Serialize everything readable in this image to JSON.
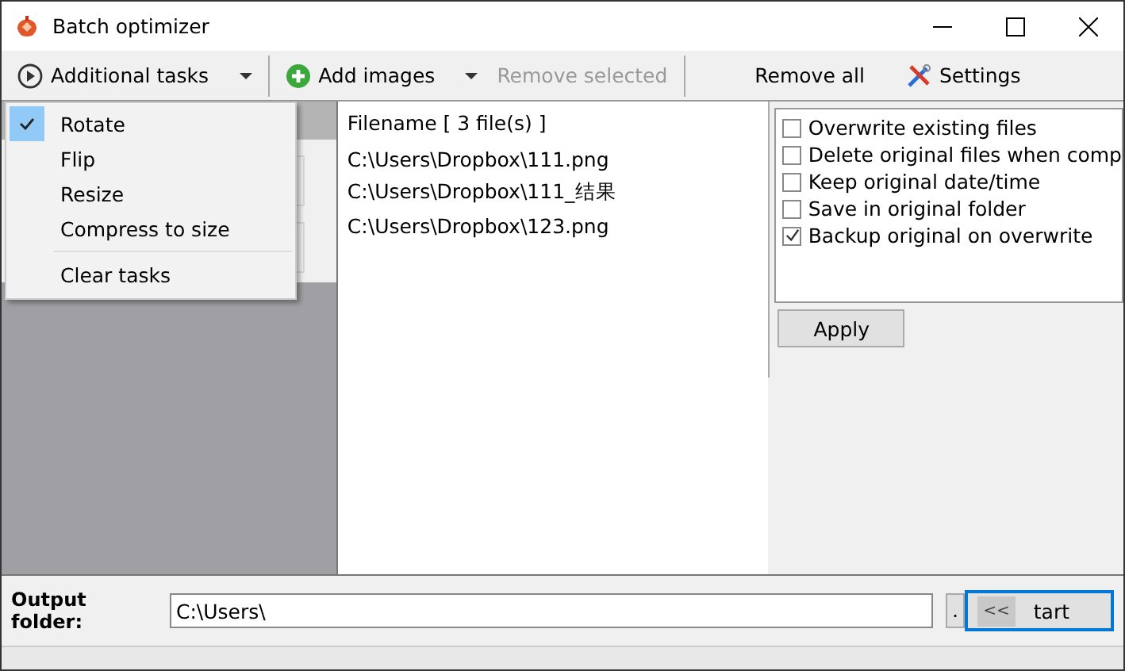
{
  "window": {
    "title": "Batch optimizer"
  },
  "toolbar": [
    {
      "kind": "dropdown",
      "label": "Additional tasks",
      "disabled": false
    },
    {
      "kind": "dropdown",
      "label": "Add images",
      "disabled": false
    },
    {
      "kind": "button",
      "label": "Remove selected",
      "disabled": true
    },
    {
      "kind": "button",
      "label": "Remove all",
      "disabled": false
    },
    {
      "kind": "button",
      "label": "Settings",
      "disabled": false
    }
  ],
  "menu": [
    {
      "kind": "option",
      "label": "Rotate",
      "checked": true
    },
    {
      "kind": "option",
      "label": "Flip",
      "checked": false
    },
    {
      "kind": "option",
      "label": "Resize",
      "checked": false
    },
    {
      "kind": "option",
      "label": "Compress to size",
      "checked": false
    },
    {
      "kind": "action",
      "label": "Clear tasks",
      "checked": false
    }
  ],
  "file_list": {
    "header": "Filename [ 3 file(s) ]",
    "files": [
      "C:\\Users\\Dropbox\\111.png",
      "C:\\Users\\Dropbox\\111_结果",
      "C:\\Users\\Dropbox\\123.png"
    ]
  },
  "options": [
    {
      "label": "Overwrite existing files",
      "checked": false
    },
    {
      "label": "Delete original files when comp",
      "checked": false
    },
    {
      "label": "Keep original date/time",
      "checked": false
    },
    {
      "label": "Save in original folder",
      "checked": false
    },
    {
      "label": "Backup original on overwrite",
      "checked": true
    }
  ],
  "apply_button": "Apply",
  "output": {
    "label": "Output folder:",
    "value": "C:\\Users\\",
    "browse": ".",
    "start": "tart",
    "collapse": "<<"
  }
}
